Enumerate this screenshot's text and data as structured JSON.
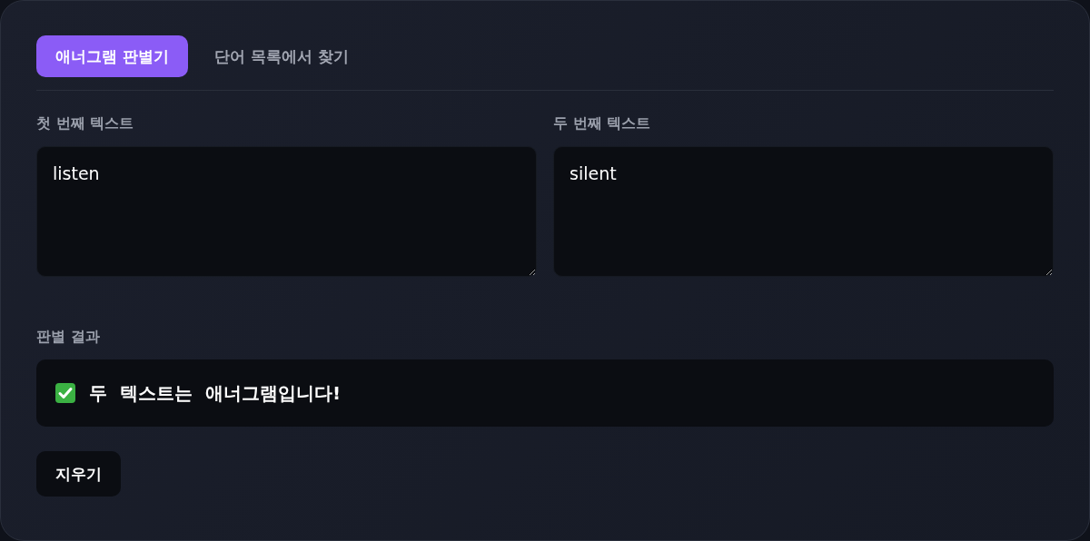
{
  "tabs": [
    {
      "label": "애너그램 판별기",
      "selected": true
    },
    {
      "label": "단어 목록에서 찾기",
      "selected": false
    }
  ],
  "fields": [
    {
      "label": "첫 번째 텍스트",
      "value": "listen"
    },
    {
      "label": "두 번째 텍스트",
      "value": "silent"
    }
  ],
  "result": {
    "label": "판별 결과",
    "kind": "success",
    "text": "두 텍스트는 애너그램입니다!"
  },
  "buttons": [
    "지우기"
  ]
}
